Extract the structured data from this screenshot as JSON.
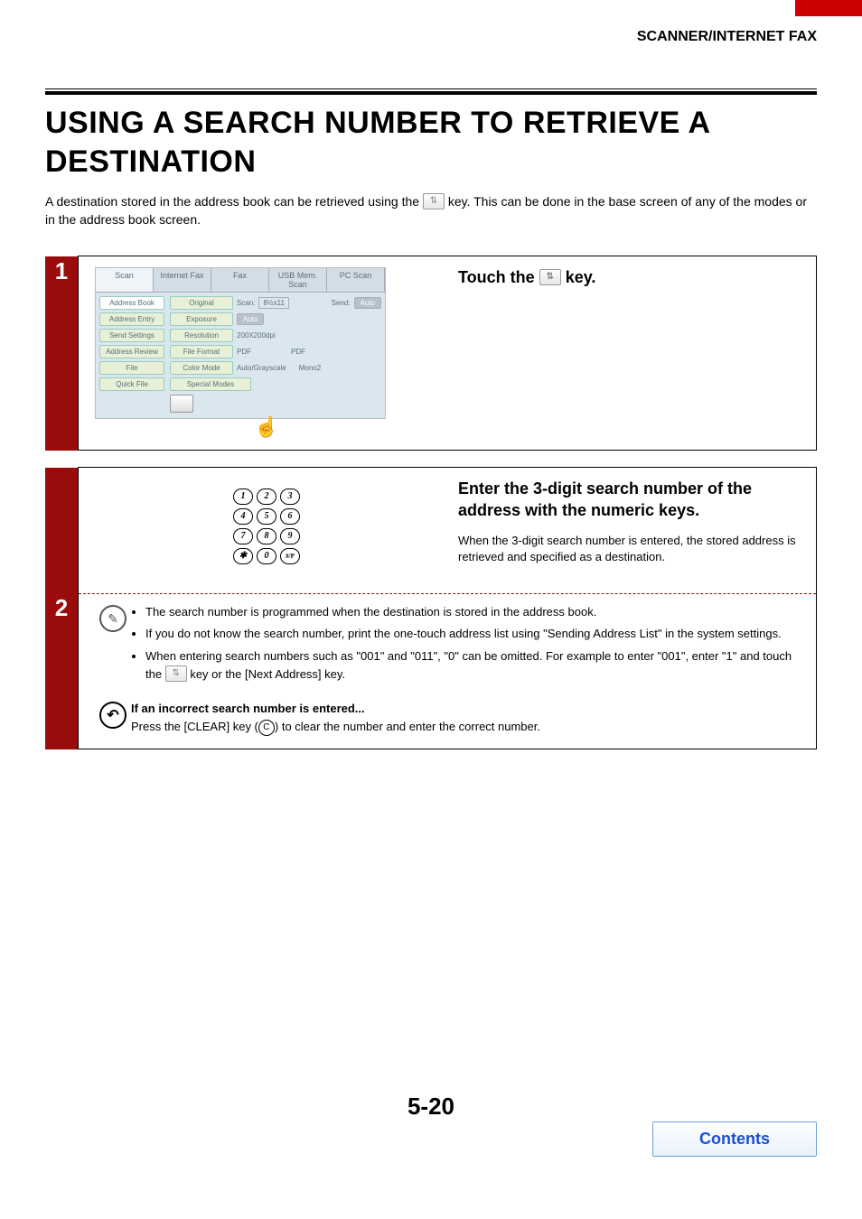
{
  "header": {
    "section": "SCANNER/INTERNET FAX"
  },
  "title": "USING A SEARCH NUMBER TO RETRIEVE A DESTINATION",
  "intro": {
    "before_icon": "A destination stored in the address book can be retrieved using the ",
    "after_icon": " key. This can be done in the base screen of any of the modes or in the address book screen."
  },
  "steps": {
    "s1": {
      "num": "1",
      "heading_before": "Touch the ",
      "heading_after": " key.",
      "screen": {
        "tabs": [
          "Scan",
          "Internet Fax",
          "Fax",
          "USB Mem. Scan",
          "PC Scan"
        ],
        "side": [
          "Address Book",
          "Address Entry",
          "Send Settings",
          "Address Review",
          "File",
          "Quick File"
        ],
        "rows": [
          {
            "label": "Original",
            "scan": "Scan:",
            "scanval": "8½x11",
            "send": "Send:",
            "sendval": "Auto"
          },
          {
            "label": "Exposure",
            "val": "Auto"
          },
          {
            "label": "Resolution",
            "val": "200X200dpi"
          },
          {
            "label": "File Format",
            "val": "PDF",
            "val2": "PDF"
          },
          {
            "label": "Color Mode",
            "val": "Auto/Grayscale",
            "val2": "Mono2"
          },
          {
            "label": "Special Modes"
          }
        ]
      }
    },
    "s2": {
      "num": "2",
      "heading": "Enter the 3-digit search number of the address with the numeric keys.",
      "body": "When the 3-digit search number is entered, the stored address is retrieved and specified as a destination.",
      "keys": [
        [
          "1",
          "2",
          "3"
        ],
        [
          "4",
          "5",
          "6"
        ],
        [
          "7",
          "8",
          "9"
        ],
        [
          "✱",
          "0",
          "#/P"
        ]
      ],
      "bullets": [
        "The search number is programmed when the destination is stored in the address book.",
        "If you do not know the search number, print the one-touch address list using \"Sending Address List\" in the system settings.",
        "When entering search numbers such as \"001\" and \"011\", \"0\" can be omitted. For example to enter \"001\", enter \"1\" and touch the "
      ],
      "bullet3_after": " key or the [Next Address] key.",
      "incorrect_title": "If an incorrect search number is entered...",
      "incorrect_before": "Press the [CLEAR] key (",
      "incorrect_key": "C",
      "incorrect_after": ") to clear the number and enter the correct number."
    }
  },
  "footer": {
    "page": "5-20",
    "contents": "Contents"
  }
}
